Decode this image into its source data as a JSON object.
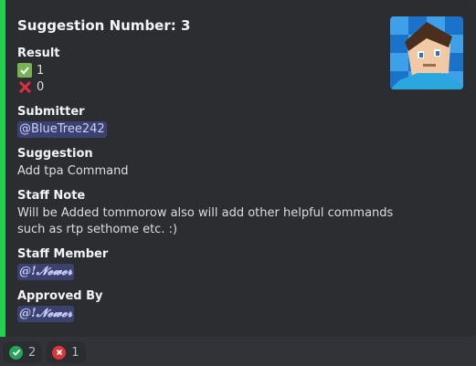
{
  "embed": {
    "accent_color": "#23d14f",
    "title": "Suggestion Number: 3",
    "thumbnail_icon": "user-avatar-thumbnail",
    "result": {
      "label": "Result",
      "upvotes": "1",
      "downvotes": "0"
    },
    "submitter": {
      "label": "Submitter",
      "mention": "@BlueTree242"
    },
    "suggestion": {
      "label": "Suggestion",
      "text": "Add tpa Command"
    },
    "staff_note": {
      "label": "Staff Note",
      "line1": "Will be Added tommorow also will add other helpful commands",
      "line2": "such as rtp sethome etc. :)"
    },
    "staff_member": {
      "label": "Staff Member",
      "mention": "@!𝓝𝓮𝔀𝓮𝓻"
    },
    "approved_by": {
      "label": "Approved By",
      "mention": "@!𝓝𝓮𝔀𝓮𝓻"
    }
  },
  "reactions": [
    {
      "icon": "green-check-icon",
      "count": "2",
      "color": "#23a55a"
    },
    {
      "icon": "red-cross-icon",
      "count": "1",
      "color": "#da373c"
    }
  ]
}
